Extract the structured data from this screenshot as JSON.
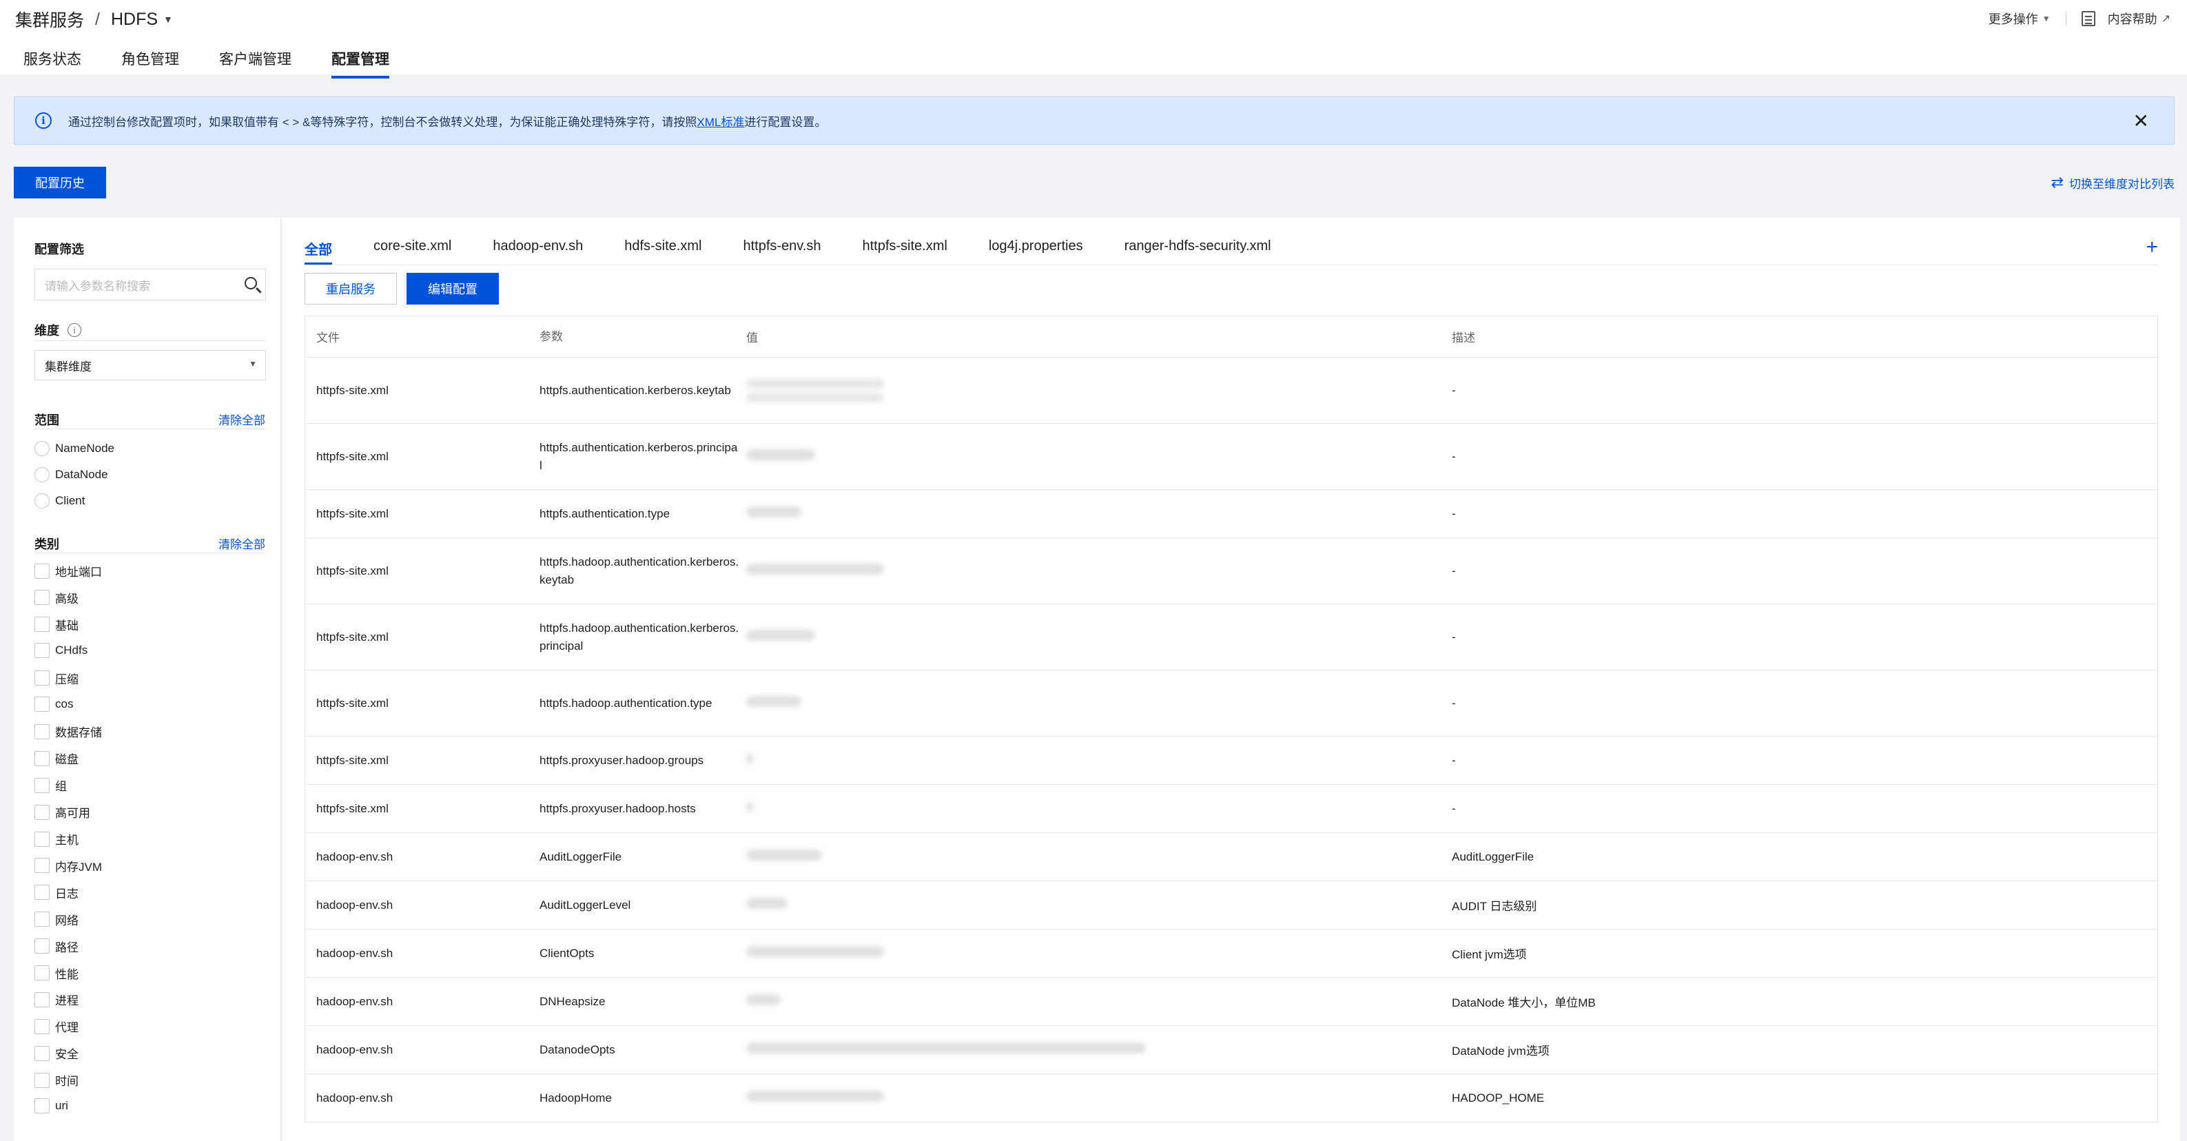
{
  "header": {
    "crumb_root": "集群服务",
    "crumb_sep": "/",
    "crumb_service": "HDFS",
    "more_ops": "更多操作",
    "help": "内容帮助",
    "tabs": [
      "服务状态",
      "角色管理",
      "客户端管理",
      "配置管理"
    ],
    "active_tab": "配置管理"
  },
  "notice": {
    "text_before": "通过控制台修改配置项时，如果取值带有 < > &等特殊字符，控制台不会做转义处理，为保证能正确处理特殊字符，请按照",
    "link": "XML标准",
    "text_after": "进行配置设置。"
  },
  "toolbar": {
    "history": "配置历史",
    "switch": "切换至维度对比列表"
  },
  "filter": {
    "title": "配置筛选",
    "search_placeholder": "请输入参数名称搜索",
    "dimension_label": "维度",
    "dimension_value": "集群维度",
    "scope_label": "范围",
    "clear_all": "清除全部",
    "scopes": [
      "NameNode",
      "DataNode",
      "Client"
    ],
    "category_label": "类别",
    "categories": [
      "地址端口",
      "高级",
      "基础",
      "CHdfs",
      "压缩",
      "cos",
      "数据存储",
      "磁盘",
      "组",
      "高可用",
      "主机",
      "内存JVM",
      "日志",
      "网络",
      "路径",
      "性能",
      "进程",
      "代理",
      "安全",
      "时间",
      "uri"
    ]
  },
  "file_tabs": [
    "全部",
    "core-site.xml",
    "hadoop-env.sh",
    "hdfs-site.xml",
    "httpfs-env.sh",
    "httpfs-site.xml",
    "log4j.properties",
    "ranger-hdfs-security.xml"
  ],
  "actions": {
    "restart": "重启服务",
    "edit": "编辑配置"
  },
  "table": {
    "headers": [
      "文件",
      "参数",
      "值",
      "描述"
    ],
    "rows": [
      {
        "file": "httpfs-site.xml",
        "param": "httpfs.authentication.kerberos.keytab",
        "desc": "-"
      },
      {
        "file": "httpfs-site.xml",
        "param": "httpfs.authentication.kerberos.principal",
        "desc": "-"
      },
      {
        "file": "httpfs-site.xml",
        "param": "httpfs.authentication.type",
        "desc": "-"
      },
      {
        "file": "httpfs-site.xml",
        "param": "httpfs.hadoop.authentication.kerberos.keytab",
        "desc": "-"
      },
      {
        "file": "httpfs-site.xml",
        "param": "httpfs.hadoop.authentication.kerberos.principal",
        "desc": "-"
      },
      {
        "file": "httpfs-site.xml",
        "param": "httpfs.hadoop.authentication.type",
        "desc": "-"
      },
      {
        "file": "httpfs-site.xml",
        "param": "httpfs.proxyuser.hadoop.groups",
        "desc": "-"
      },
      {
        "file": "httpfs-site.xml",
        "param": "httpfs.proxyuser.hadoop.hosts",
        "desc": "-"
      },
      {
        "file": "hadoop-env.sh",
        "param": "AuditLoggerFile",
        "desc": "AuditLoggerFile"
      },
      {
        "file": "hadoop-env.sh",
        "param": "AuditLoggerLevel",
        "desc": "AUDIT 日志级别"
      },
      {
        "file": "hadoop-env.sh",
        "param": "ClientOpts",
        "desc": "Client jvm选项"
      },
      {
        "file": "hadoop-env.sh",
        "param": "DNHeapsize",
        "desc": "DataNode 堆大小，单位MB"
      },
      {
        "file": "hadoop-env.sh",
        "param": "DatanodeOpts",
        "desc": "DataNode jvm选项"
      },
      {
        "file": "hadoop-env.sh",
        "param": "HadoopHome",
        "desc": "HADOOP_HOME"
      }
    ]
  }
}
